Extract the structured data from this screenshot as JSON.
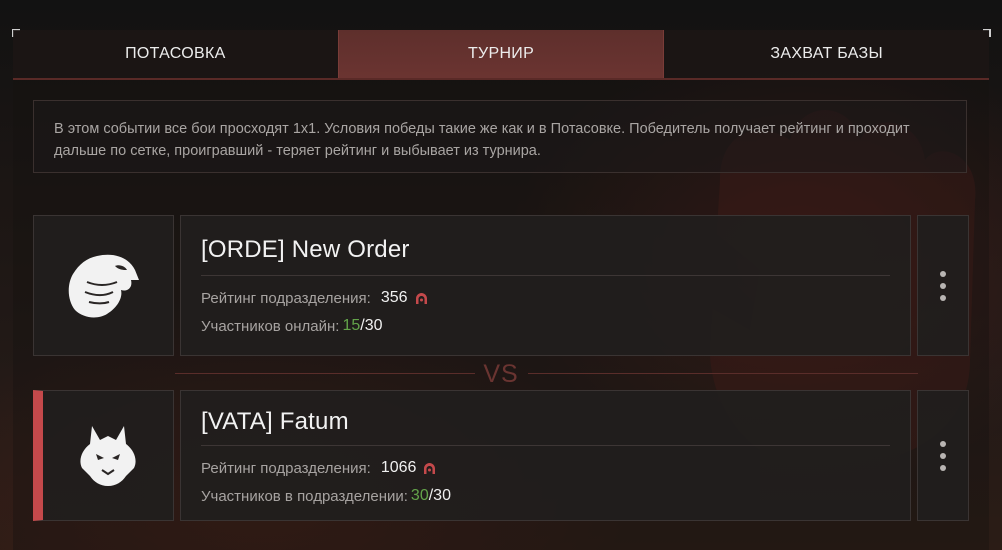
{
  "tabs": [
    {
      "label": "ПОТАСОВКА",
      "active": false
    },
    {
      "label": "ТУРНИР",
      "active": true
    },
    {
      "label": "ЗАХВАТ БАЗЫ",
      "active": false
    }
  ],
  "description": "В этом событии все бои просходят 1х1. Условия победы такие же как и в Потасовке. Победитель получает рейтинг и проходит дальше по сетке, проигравший - теряет рейтинг и выбывает из турнира.",
  "vs_label": "VS",
  "teams": [
    {
      "name": "[ORDE] New Order",
      "emblem": "eagle-icon",
      "rating_label": "Рейтинг подразделения:",
      "rating": "356",
      "members_label": "Участников онлайн:",
      "members_current": "15",
      "members_sep": "/",
      "members_total": "30"
    },
    {
      "name": "[VATA] Fatum",
      "emblem": "wolf-icon",
      "rating_label": "Рейтинг подразделения:",
      "rating": "1066",
      "members_label": "Участников в подразделении:",
      "members_current": "30",
      "members_sep": "/",
      "members_total": "30"
    }
  ],
  "colors": {
    "accent_red": "#c4494b",
    "online_green": "#63a34a",
    "active_tab": "#63312e"
  }
}
